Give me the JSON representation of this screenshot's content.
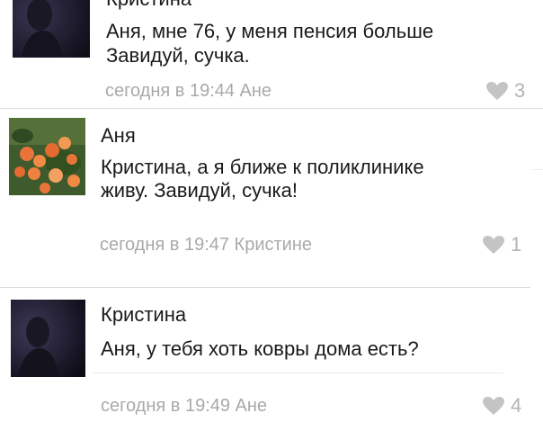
{
  "colors": {
    "text": "#1a1a1a",
    "meta": "#a9a9a9",
    "like": "#b4b4b4",
    "divider": "#dcdcdc"
  },
  "comments": [
    {
      "author": "Кристина",
      "lines": [
        "Аня, мне 76, у меня пенсия больше",
        "Завидуй, сучка."
      ],
      "meta": "сегодня в 19:44 Ане",
      "likes": "3",
      "avatar": "dark-portrait-avatar"
    },
    {
      "author": "Аня",
      "lines": [
        "Кристина, а я ближе к поликлинике",
        "живу. Завидуй, сучка!"
      ],
      "meta": "сегодня в 19:47 Кристине",
      "likes": "1",
      "avatar": "orange-flowers-avatar"
    },
    {
      "author": "Кристина",
      "lines": [
        "Аня, у тебя хоть ковры дома есть?"
      ],
      "meta": "сегодня в 19:49 Ане",
      "likes": "4",
      "avatar": "dark-portrait-avatar"
    }
  ]
}
